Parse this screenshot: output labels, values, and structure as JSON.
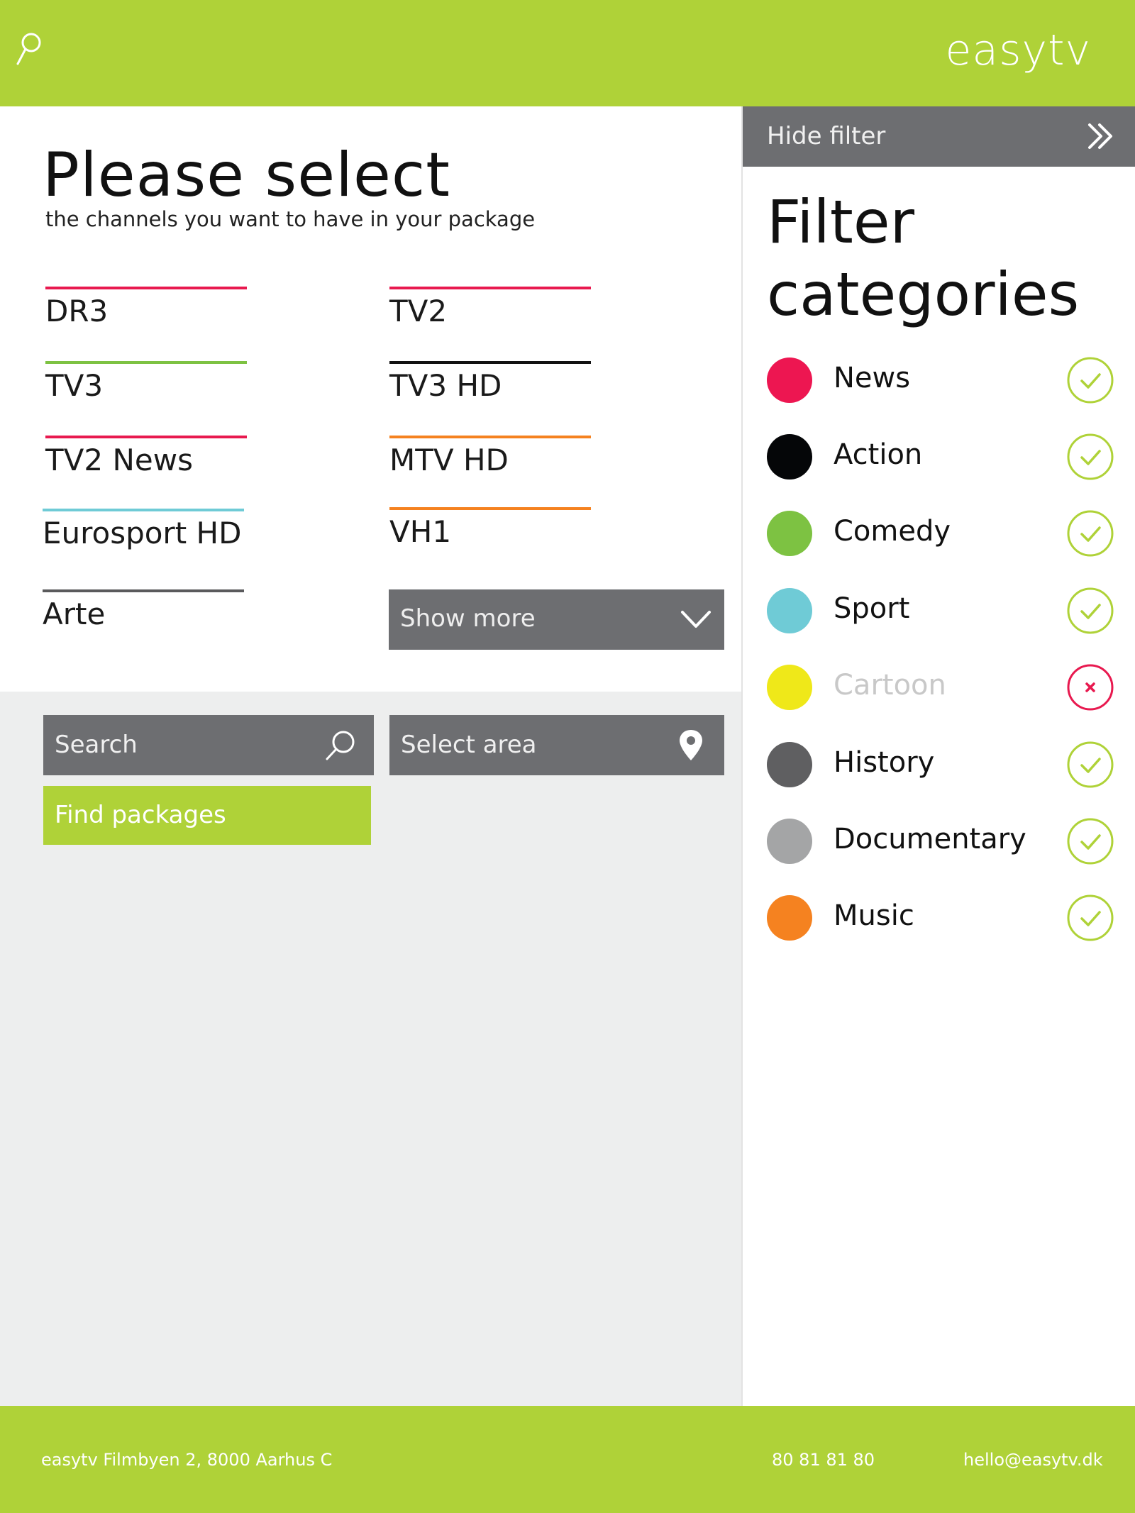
{
  "header": {
    "logo": "easytv",
    "search_icon": "search-icon"
  },
  "main": {
    "title": "Please select",
    "subtitle": "the channels you want to have in your package",
    "channels": [
      {
        "label": "DR3",
        "color": "#e8194f"
      },
      {
        "label": "TV2",
        "color": "#e8194f"
      },
      {
        "label": "TV3",
        "color": "#7dc242"
      },
      {
        "label": "TV3 HD",
        "color": "#111111"
      },
      {
        "label": "TV2 News",
        "color": "#e8194f"
      },
      {
        "label": "MTV HD",
        "color": "#f58220"
      },
      {
        "label": "Eurosport HD",
        "color": "#6fcbd6"
      },
      {
        "label": "VH1",
        "color": "#f58220"
      },
      {
        "label": "Arte",
        "color": "#5a5a5c"
      }
    ],
    "show_more_label": "Show more"
  },
  "search": {
    "placeholder": "Search",
    "area_placeholder": "Select area",
    "find_label": "Find packages"
  },
  "sidebar": {
    "hide_label": "Hide filter",
    "title_line1": "Filter",
    "title_line2": "categories",
    "categories": [
      {
        "name": "News",
        "color": "#ed1651",
        "selected": true
      },
      {
        "name": "Action",
        "color": "#050608",
        "selected": true
      },
      {
        "name": "Comedy",
        "color": "#7dc242",
        "selected": true
      },
      {
        "name": "Sport",
        "color": "#6fcbd6",
        "selected": true
      },
      {
        "name": "Cartoon",
        "color": "#efe819",
        "selected": false
      },
      {
        "name": "History",
        "color": "#5f5f61",
        "selected": true
      },
      {
        "name": "Documentary",
        "color": "#a4a5a6",
        "selected": true
      },
      {
        "name": "Music",
        "color": "#f58220",
        "selected": true
      }
    ]
  },
  "footer": {
    "address": "easytv  Filmbyen 2, 8000 Aarhus C",
    "phone": "80 81 81 80",
    "email": "hello@easytv.dk"
  },
  "colors": {
    "accent": "#afd238",
    "panel": "#6d6e71",
    "background_lower": "#edeeee",
    "unselected": "#e8194f"
  }
}
